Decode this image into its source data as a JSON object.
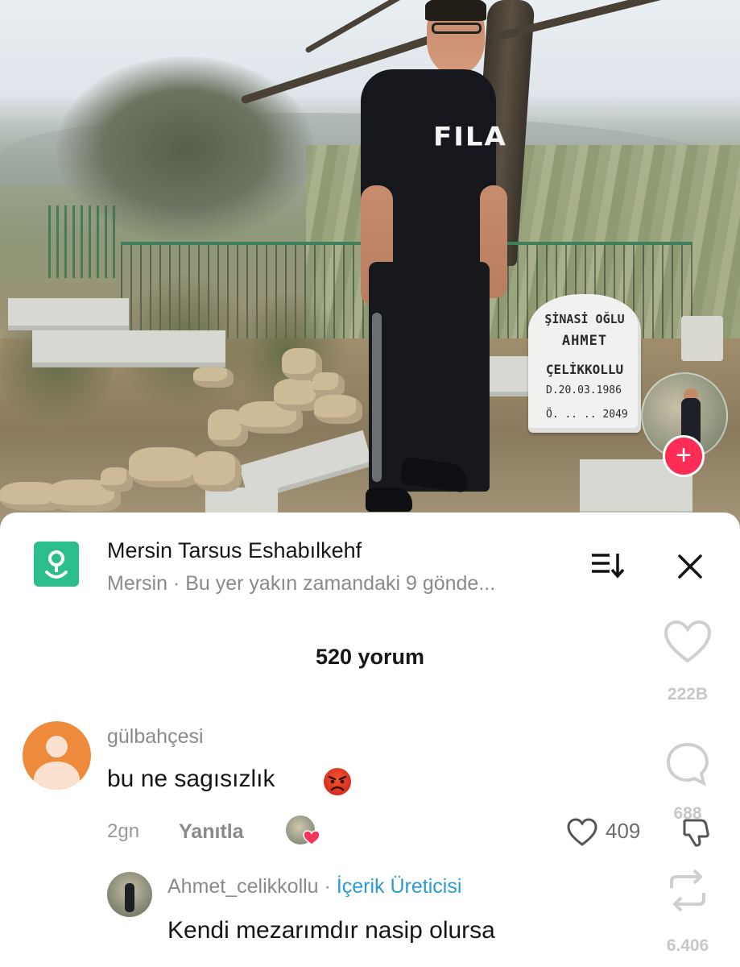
{
  "photo": {
    "shirt_brand": "FILA",
    "headstone": {
      "line1": "ŞİNASİ OĞLU",
      "line2": "AHMET",
      "line3": "ÇELİKKOLLU",
      "line4": "D.20.03.1986",
      "line5": "Ö. .. .. 2049"
    }
  },
  "location": {
    "title": "Mersin Tarsus Eshabılkehf",
    "subtitle": "Mersin · Bu yer yakın zamandaki 9 gönde..."
  },
  "comments_count": "520 yorum",
  "side_actions": {
    "likes": "222B",
    "comments": "688",
    "shares": "6.406"
  },
  "comment": {
    "username": "gülbahçesi",
    "text": "bu ne sagısızlık",
    "time": "2gn",
    "reply_label": "Yanıtla",
    "likes": "409"
  },
  "reply": {
    "username": "Ahmet_celikkollu",
    "separator": "·",
    "badge": "İçerik Üreticisi",
    "text": "Kendi mezarımdır nasip olursa"
  },
  "colors": {
    "location_icon_bg": "#2bbd8b",
    "plus_button": "#fd2c55",
    "creator_badge": "#2b9bd8",
    "avatar_orange": "#ed8a3b"
  }
}
